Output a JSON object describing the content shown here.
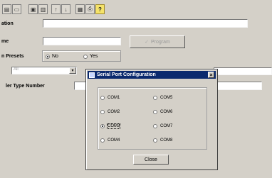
{
  "toolbar": {
    "buttons": [
      {
        "name": "new-icon",
        "glyph": "▤"
      },
      {
        "name": "open-icon",
        "glyph": "▭"
      },
      {
        "name": "save-icon",
        "glyph": "▣"
      },
      {
        "name": "copy-icon",
        "glyph": "▥"
      },
      {
        "name": "arrow-up-icon",
        "glyph": "↑"
      },
      {
        "name": "arrow-down-icon",
        "glyph": "↓"
      },
      {
        "name": "preview-icon",
        "glyph": "▦"
      },
      {
        "name": "print-icon",
        "glyph": "⎙"
      },
      {
        "name": "help-icon",
        "glyph": "?"
      }
    ]
  },
  "form": {
    "label_1": "ation",
    "label_2": "me",
    "program_button": "Program",
    "presets_label": "n Presets",
    "presets_no": "No",
    "presets_yes": "Yes",
    "dropdown_value": "All",
    "dropdown_arrow": "▾",
    "type_number_label": "ler Type Number"
  },
  "dialog": {
    "title": "Serial Port Configuration",
    "close_glyph": "×",
    "ports": [
      "COM1",
      "COM2",
      "COM3",
      "COM4",
      "COM5",
      "COM6",
      "COM7",
      "COM8"
    ],
    "selected": "COM3",
    "close_button": "Close"
  }
}
